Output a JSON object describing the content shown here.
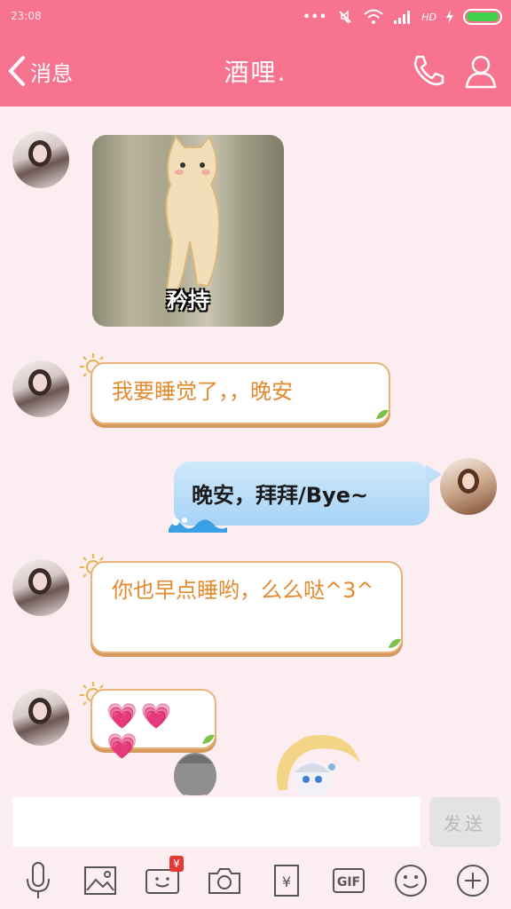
{
  "status_bar": {
    "time": "23:08",
    "network": "HD",
    "battery_color": "#3fd24a"
  },
  "header": {
    "back_label": "消息",
    "title": "酒哩.",
    "icons": [
      "phone-icon",
      "profile-icon"
    ]
  },
  "messages": [
    {
      "side": "left",
      "type": "sticker",
      "caption": "矜持"
    },
    {
      "side": "left",
      "type": "text",
      "text": "我要睡觉了，，晚安"
    },
    {
      "side": "right",
      "type": "text",
      "text": "晚安，拜拜/Bye~"
    },
    {
      "side": "left",
      "type": "text",
      "text": "你也早点睡哟，么么哒^3^"
    },
    {
      "side": "left",
      "type": "text",
      "text": "💗💗💗"
    }
  ],
  "input": {
    "placeholder": "",
    "send_label": "发送"
  },
  "toolbar": {
    "items": [
      "mic-icon",
      "image-icon",
      "red-packet-video-icon",
      "camera-icon",
      "wallet-icon",
      "gif-icon",
      "emoji-icon",
      "plus-icon"
    ],
    "badge": "¥",
    "gif_label": "GIF",
    "wallet_label": "¥"
  },
  "colors": {
    "header_pink": "#f7738f",
    "chat_bg": "#fceef0",
    "left_text": "#e48a2e",
    "right_bubble": "#a7d3f6"
  }
}
